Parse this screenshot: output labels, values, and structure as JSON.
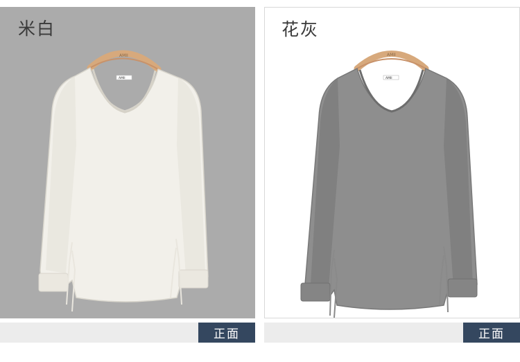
{
  "products": [
    {
      "color_name": "米白",
      "view_label": "正面",
      "sweater_color": "#f2f0ea",
      "shade_color": "#dcd9d0",
      "hanger_brand": "AMII",
      "neck_label": "AMII"
    },
    {
      "color_name": "花灰",
      "view_label": "正面",
      "sweater_color": "#8e8e8e",
      "shade_color": "#6f6f6f",
      "hanger_brand": "AMII",
      "neck_label": "AMII"
    }
  ]
}
